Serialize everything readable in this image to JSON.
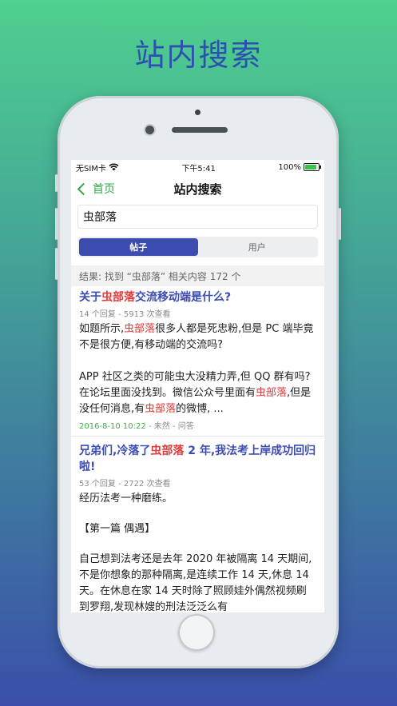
{
  "headline": "站内搜索",
  "status": {
    "carrier": "无SIM卡",
    "time": "下午5:41",
    "battery": "100%"
  },
  "nav": {
    "back_label": "首页",
    "title": "站内搜索"
  },
  "search": {
    "value": "虫部落"
  },
  "tabs": [
    {
      "label": "帖子",
      "active": true
    },
    {
      "label": "用户",
      "active": false
    }
  ],
  "result_summary": "结果: 找到 “虫部落” 相关内容 172 个",
  "posts": [
    {
      "title_pre": "关于",
      "title_hl": "虫部落",
      "title_post": "交流移动端是什么?",
      "stats": "14 个回复 - 5913 次查看",
      "body_1_pre": "如题所示,",
      "body_1_hl": "虫部落",
      "body_1_post": "很多人都是死忠粉,但是 PC 端毕竟不是很方便,有移动端的交流吗?",
      "body_2_pre": "APP 社区之类的可能虫大没精力弄,但 QQ 群有吗?在论坛里面没找到。微信公众号里面有",
      "body_2_hl": "虫部落",
      "body_2_mid": ",但是没任何消息,有",
      "body_2_hl2": "虫部落",
      "body_2_post": "的微博, ...",
      "date": "2016-8-10 10:22",
      "author": "未然",
      "category": "问答"
    },
    {
      "title_pre": "兄弟们,冷落了",
      "title_hl": "虫部落",
      "title_post": " 2 年,我法考上岸成功回归啦!",
      "stats": "53 个回复 - 2722 次查看",
      "body_1": "经历法考一种磨练。",
      "body_2": "【第一篇 偶遇】",
      "body_3": "自己想到法考还是去年 2020 年被隔离 14 天期间,不是你想象的那种隔离,是连续工作 14 天,休息 14 天。在休息在家 14 天时除了照顾娃外偶然视频刷到罗翔,发现林嫂的刑法泛泛么有"
    }
  ]
}
